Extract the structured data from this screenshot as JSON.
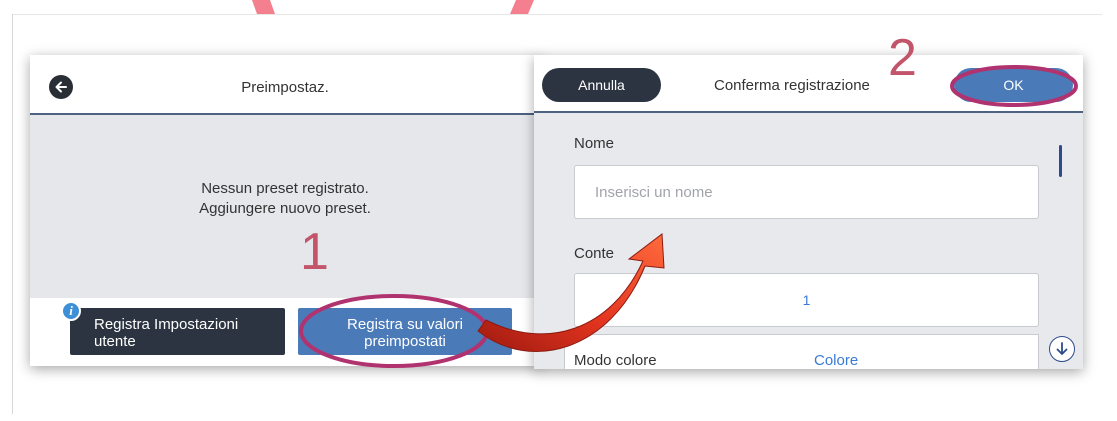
{
  "left_panel": {
    "back_icon": "arrow-left-icon",
    "title": "Preimpostaz.",
    "empty_line1": "Nessun preset registrato.",
    "empty_line2": "Aggiungere nuovo preset.",
    "btn_user_line1": "Registra Impostazioni",
    "btn_user_line2": "utente",
    "btn_preset_line1": "Registra su valori",
    "btn_preset_line2": "preimpostati",
    "info_icon": "info-icon",
    "info_glyph": "i"
  },
  "right_panel": {
    "cancel_label": "Annulla",
    "title": "Conferma registrazione",
    "ok_label": "OK",
    "name_label": "Nome",
    "name_placeholder": "Inserisci un nome",
    "name_value": "",
    "content_label": "Contenuto",
    "copies_value": "1",
    "color_mode_label": "Modo colore",
    "color_mode_value": "Colore",
    "scroll_down_icon": "arrow-down-circle-icon"
  },
  "annotations": {
    "step1": "1",
    "step2": "2"
  },
  "colors": {
    "highlight_ellipse": "#b0336f",
    "arrow_red": "#e2341f",
    "accent_blue": "#4b7ab8",
    "dark_button": "#2b3440"
  }
}
